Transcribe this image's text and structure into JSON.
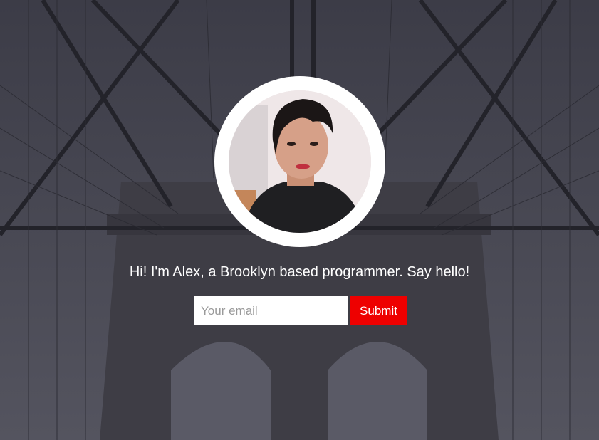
{
  "hero": {
    "background_image": "brooklyn-bridge-photo",
    "overlay_color": "#4a4a55"
  },
  "profile": {
    "avatar_image": "portrait-photo"
  },
  "intro_text": "Hi! I'm Alex, a Brooklyn based programmer. Say hello!",
  "signup": {
    "email_placeholder": "Your email",
    "email_value": "",
    "submit_label": "Submit",
    "submit_color": "#ee0000"
  }
}
